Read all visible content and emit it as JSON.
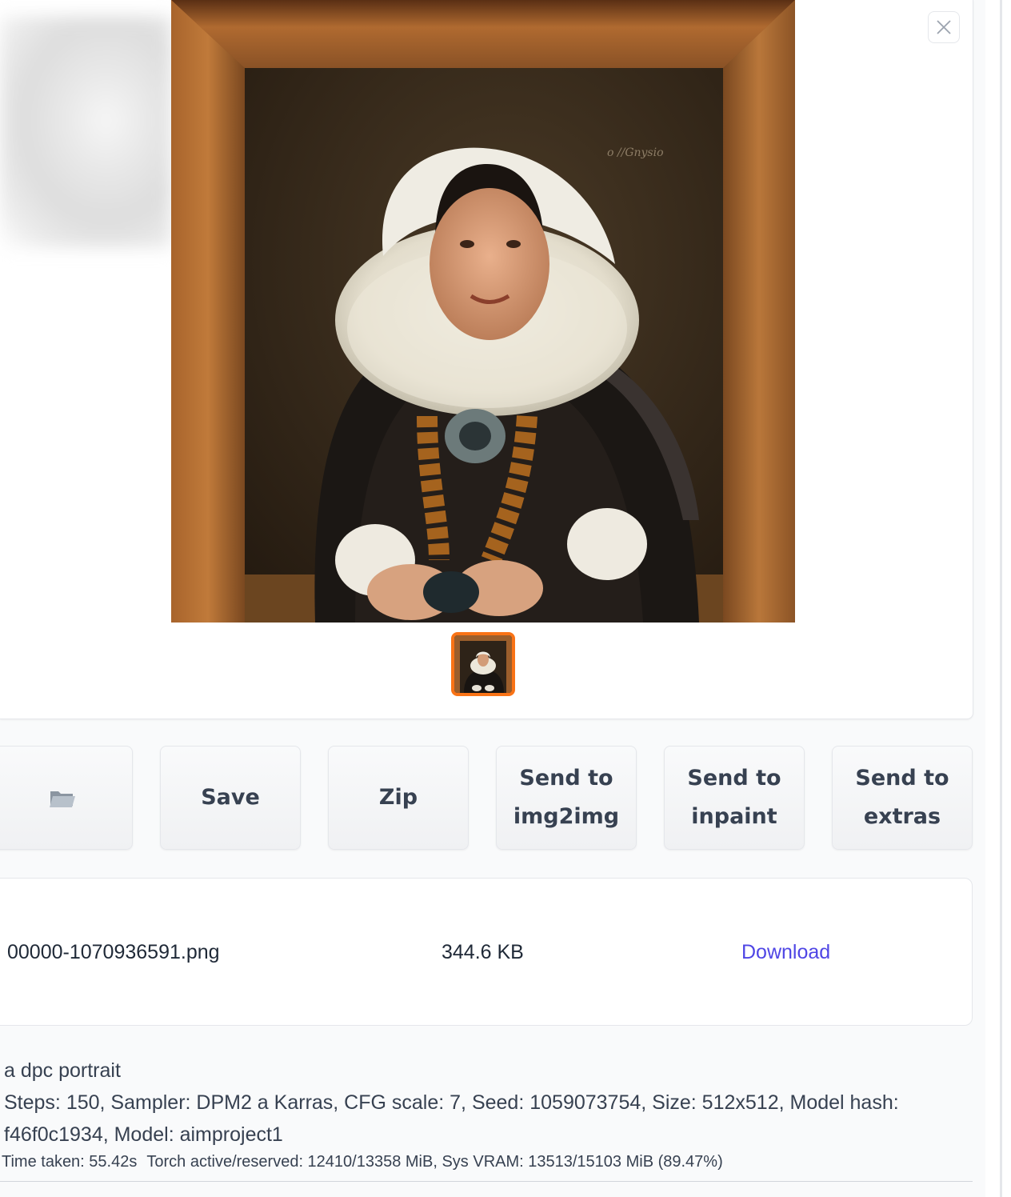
{
  "gallery": {
    "main_image_alt": "portrait",
    "thumbnail_alt": "portrait thumbnail",
    "close_icon": "close-icon"
  },
  "actions": {
    "folder_icon": "folder-icon",
    "save_label": "Save",
    "zip_label": "Zip",
    "send_img2img_label": "Send to\nimg2img",
    "send_inpaint_label": "Send to\ninpaint",
    "send_extras_label": "Send to\nextras"
  },
  "files": [
    {
      "name": "00000-1070936591.png",
      "size": "344.6 KB",
      "link_label": "Download"
    }
  ],
  "generation_info": {
    "prompt": "a dpc portrait",
    "params": "Steps: 150, Sampler: DPM2 a Karras, CFG scale: 7, Seed: 1059073754, Size: 512x512, Model hash: f46f0c1934, Model: aimproject1",
    "time_taken": "Time taken: 55.42s",
    "memory": "Torch active/reserved: 12410/13358 MiB, Sys VRAM: 13513/15103 MiB (89.47%)"
  },
  "colors": {
    "accent_orange": "#f97316",
    "link_indigo": "#4f46e5"
  }
}
